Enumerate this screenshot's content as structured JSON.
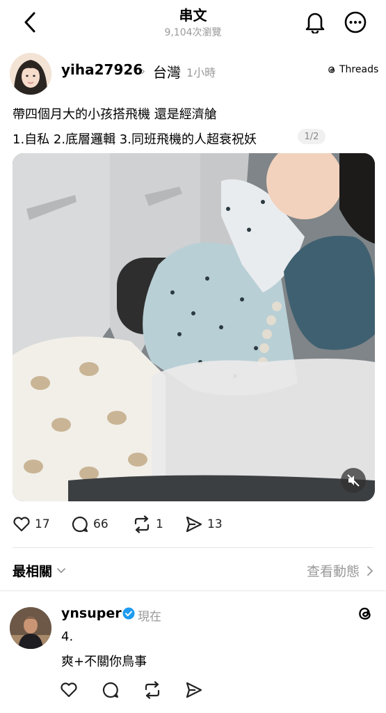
{
  "header": {
    "title": "串文",
    "views": "9,104次瀏覽"
  },
  "post": {
    "username": "yiha27926",
    "location": "台灣",
    "time": "1小時",
    "app_badge": "Threads",
    "text_line1": "帶四個月大的小孩搭飛機 還是經濟艙",
    "text_line2": "1.自私 2.底層邏輯 3.同班飛機的人超衰祝妖",
    "page_indicator": "1/2",
    "actions": {
      "likes": "17",
      "comments": "66",
      "reposts": "1",
      "shares": "13"
    }
  },
  "sort": {
    "label": "最相關",
    "activity_label": "查看動態"
  },
  "reply": {
    "username": "ynsuper",
    "time": "現在",
    "line1": "4.",
    "line2": "爽+不關你鳥事"
  },
  "icons": [
    "back-icon",
    "notification-bell-icon",
    "more-options-icon",
    "threads-logo-icon",
    "mute-icon",
    "heart-icon",
    "comment-icon",
    "repost-icon",
    "share-icon",
    "chevron-down-icon",
    "chevron-right-icon",
    "verified-badge-icon"
  ],
  "colors": {
    "verified": "#1d9bf0",
    "muted_text": "#999999",
    "divider": "#e6e6e6"
  }
}
